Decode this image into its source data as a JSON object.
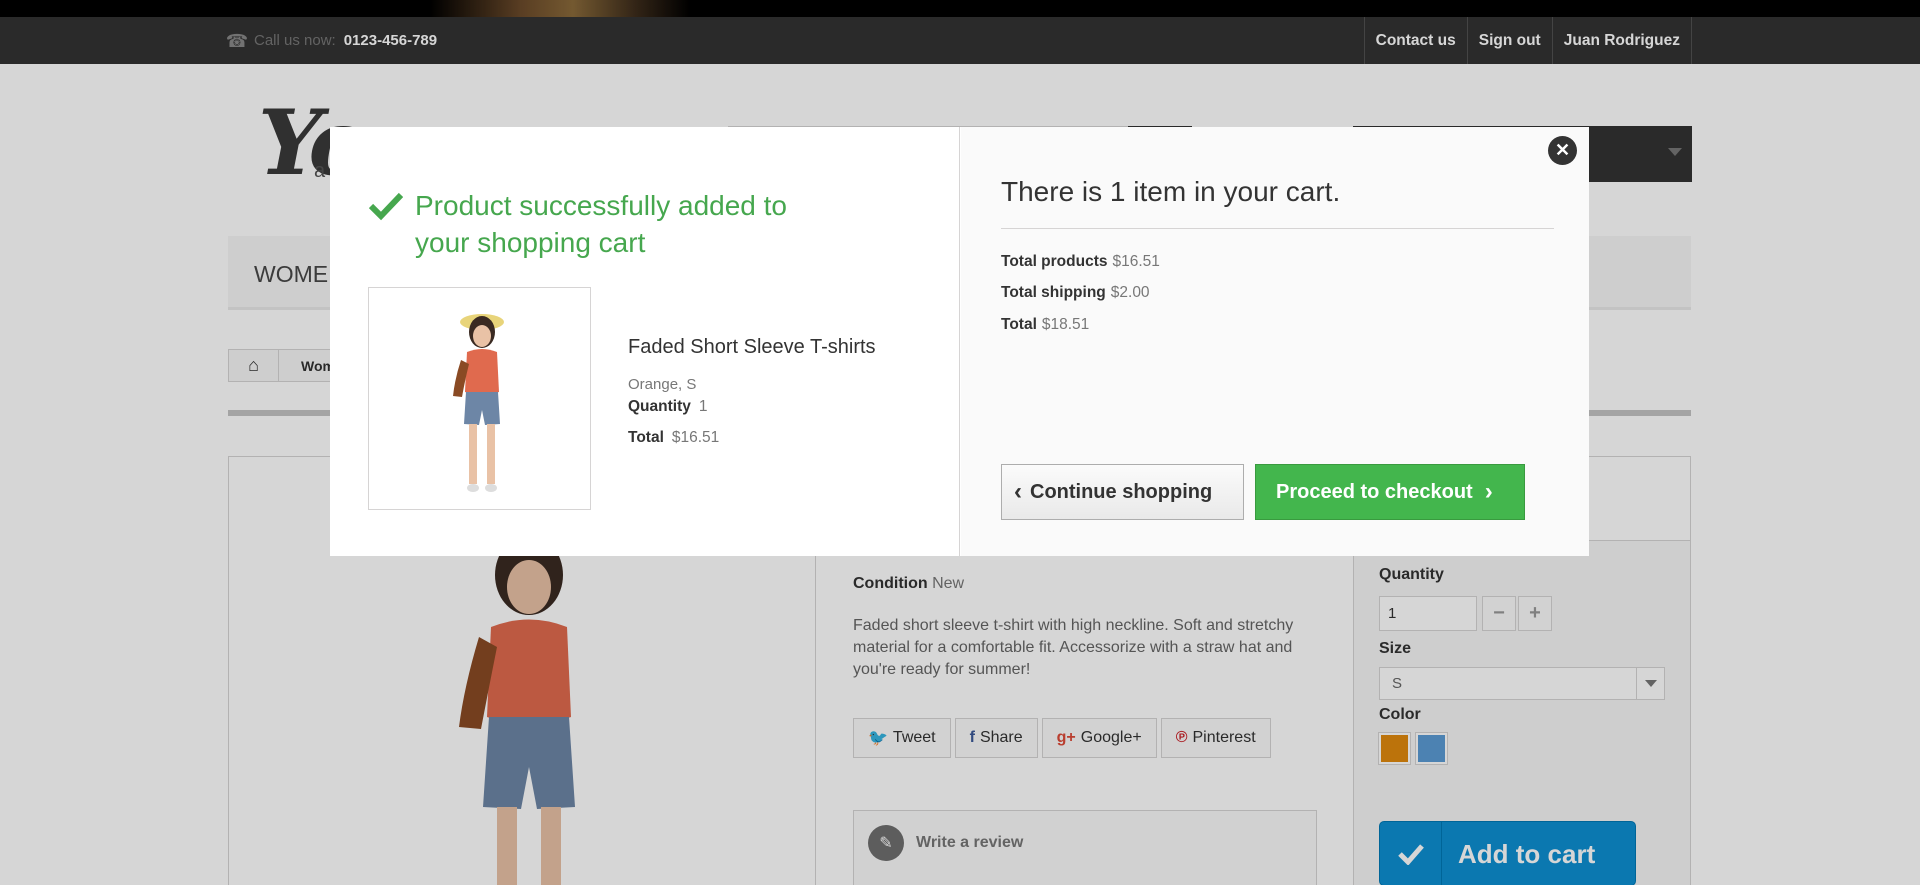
{
  "topnav": {
    "call_label": "Call us now:",
    "phone": "0123-456-789",
    "links": [
      "Contact us",
      "Sign out",
      "Juan Rodriguez"
    ]
  },
  "menu": {
    "first_item": "WOMEN"
  },
  "breadcrumb": {
    "text": "Women"
  },
  "product_page": {
    "condition_label": "Condition",
    "condition_value": "New",
    "description": "Faded short sleeve t-shirt with high neckline. Soft and stretchy material for a comfortable fit. Accessorize with a straw hat and you're ready for summer!",
    "social": [
      "Tweet",
      "Share",
      "Google+",
      "Pinterest"
    ],
    "write_review": "Write a review",
    "quantity_label": "Quantity",
    "quantity_value": "1",
    "size_label": "Size",
    "size_value": "S",
    "color_label": "Color",
    "colors": [
      "#e08a0e",
      "#5b9bd5"
    ],
    "add_to_cart": "Add to cart"
  },
  "modal": {
    "success_message": "Product successfully added to your shopping cart",
    "product_name": "Faded Short Sleeve T-shirts",
    "product_attributes": "Orange, S",
    "quantity_label": "Quantity",
    "quantity_value": "1",
    "total_label": "Total",
    "total_value": "$16.51",
    "cart_count_text": "There is 1 item in your cart.",
    "total_products_label": "Total products",
    "total_products_value": "$16.51",
    "total_shipping_label": "Total shipping",
    "total_shipping_value": "$2.00",
    "grand_total_label": "Total",
    "grand_total_value": "$18.51",
    "continue_label": "Continue shopping",
    "checkout_label": "Proceed to checkout"
  },
  "colors": {
    "success_green": "#46a74e",
    "checkout_button": "#43b64d",
    "add_to_cart_button": "#0e8fd2",
    "topbar": "#333333"
  }
}
